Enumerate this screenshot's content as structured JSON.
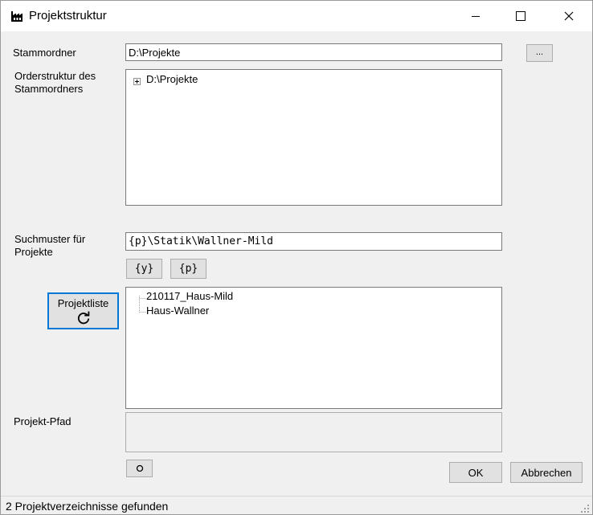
{
  "window": {
    "title": "Projektstruktur",
    "app_icon": "factory-icon"
  },
  "titlebar_buttons": {
    "minimize": "minimize-icon",
    "maximize": "maximize-icon",
    "close": "close-icon"
  },
  "stammordner": {
    "label": "Stammordner",
    "value": "D:\\Projekte",
    "browse_label": "..."
  },
  "folder_tree": {
    "label": "Orderstruktur des Stammordners",
    "root": "D:\\Projekte",
    "expander_icon": "plus-expand-icon"
  },
  "search_pattern": {
    "label": "Suchmuster für Projekte",
    "value": "{p}\\Statik\\Wallner-Mild",
    "btn_year": "{y}",
    "btn_project": "{p}"
  },
  "project_list": {
    "button_label": "Projektliste",
    "refresh_icon": "refresh-icon",
    "items": [
      "210117_Haus-Mild",
      "Haus-Wallner"
    ]
  },
  "project_path": {
    "label": "Projekt-Pfad",
    "value": "",
    "open_icon": "circle-icon"
  },
  "actions": {
    "ok": "OK",
    "cancel": "Abbrechen"
  },
  "status": {
    "text": "2 Projektverzeichnisse gefunden"
  },
  "colors": {
    "focus_border": "#0078d7",
    "button_face": "#e1e1e1",
    "window_bg": "#f0f0f0"
  }
}
